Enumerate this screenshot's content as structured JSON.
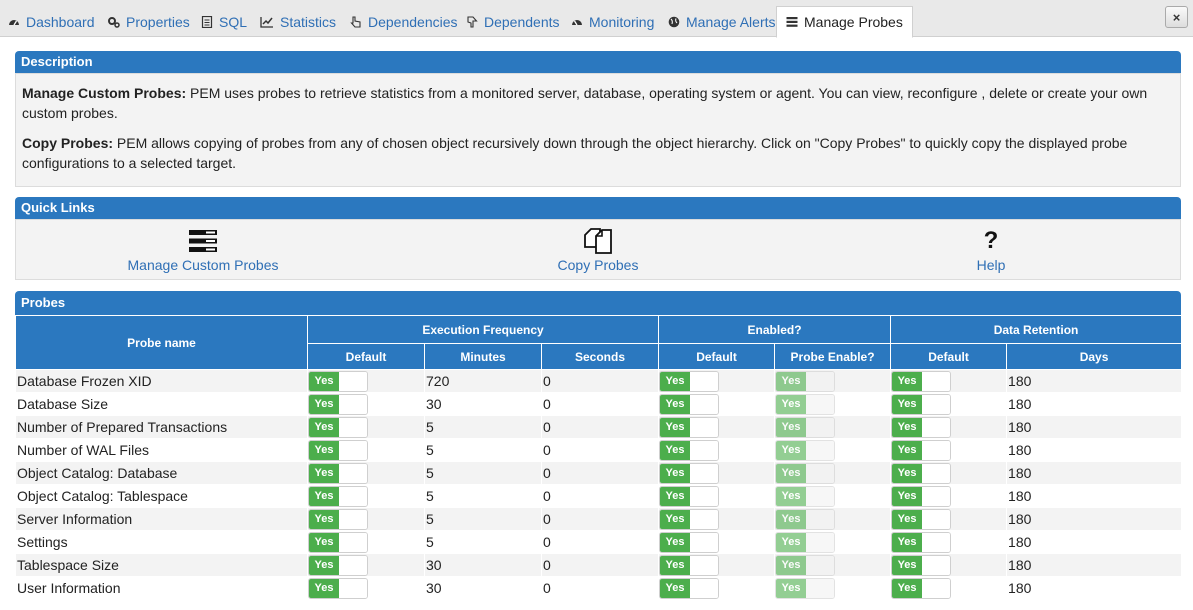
{
  "tabs": [
    {
      "label": "Dashboard",
      "icon": "dashboard-icon"
    },
    {
      "label": "Properties",
      "icon": "properties-icon"
    },
    {
      "label": "SQL",
      "icon": "sql-icon"
    },
    {
      "label": "Statistics",
      "icon": "statistics-icon"
    },
    {
      "label": "Dependencies",
      "icon": "dependencies-icon"
    },
    {
      "label": "Dependents",
      "icon": "dependents-icon"
    },
    {
      "label": "Monitoring",
      "icon": "monitoring-icon"
    },
    {
      "label": "Manage Alerts",
      "icon": "globe-icon"
    },
    {
      "label": "Manage Probes",
      "icon": "probes-icon",
      "active": true
    }
  ],
  "close_label": "×",
  "description": {
    "header": "Description",
    "p1_bold": "Manage Custom Probes:",
    "p1_text": " PEM uses probes to retrieve statistics from a monitored server, database, operating system or agent. You can view, reconfigure , delete or create your own custom probes.",
    "p2_bold": "Copy Probes:",
    "p2_text": " PEM allows copying of probes from any of chosen object recursively down through the object hierarchy. Click on \"Copy Probes\" to quickly copy the displayed probe configurations to a selected target."
  },
  "quick_links": {
    "header": "Quick Links",
    "items": [
      {
        "label": "Manage Custom Probes",
        "icon": "list-icon"
      },
      {
        "label": "Copy Probes",
        "icon": "copy-icon"
      },
      {
        "label": "Help",
        "icon": "help-icon"
      }
    ]
  },
  "probes": {
    "header": "Probes",
    "columns": {
      "probe_name": "Probe name",
      "execution_frequency": "Execution Frequency",
      "enabled": "Enabled?",
      "data_retention": "Data Retention",
      "default": "Default",
      "minutes": "Minutes",
      "seconds": "Seconds",
      "probe_enable": "Probe Enable?",
      "days": "Days"
    },
    "toggle_label": "Yes",
    "rows": [
      {
        "name": "Database Frozen XID",
        "minutes": "720",
        "seconds": "0",
        "days": "180"
      },
      {
        "name": "Database Size",
        "minutes": "30",
        "seconds": "0",
        "days": "180"
      },
      {
        "name": "Number of Prepared Transactions",
        "minutes": "5",
        "seconds": "0",
        "days": "180"
      },
      {
        "name": "Number of WAL Files",
        "minutes": "5",
        "seconds": "0",
        "days": "180"
      },
      {
        "name": "Object Catalog: Database",
        "minutes": "5",
        "seconds": "0",
        "days": "180"
      },
      {
        "name": "Object Catalog: Tablespace",
        "minutes": "5",
        "seconds": "0",
        "days": "180"
      },
      {
        "name": "Server Information",
        "minutes": "5",
        "seconds": "0",
        "days": "180"
      },
      {
        "name": "Settings",
        "minutes": "5",
        "seconds": "0",
        "days": "180"
      },
      {
        "name": "Tablespace Size",
        "minutes": "30",
        "seconds": "0",
        "days": "180"
      },
      {
        "name": "User Information",
        "minutes": "30",
        "seconds": "0",
        "days": "180"
      }
    ]
  },
  "colors": {
    "header_blue": "#2b78bf",
    "link_blue": "#2f6fb5",
    "toggle_green": "#4cae4c"
  }
}
